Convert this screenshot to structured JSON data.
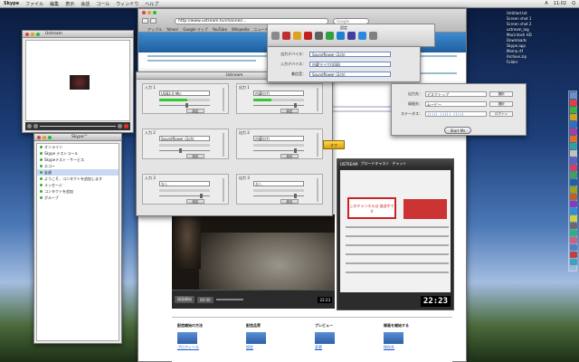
{
  "menubar": {
    "app": "Skype",
    "items": [
      "ファイル",
      "編集",
      "表示",
      "会話",
      "コール",
      "ウィンドウ",
      "ヘルプ"
    ],
    "right_items": [
      "A",
      "11:02",
      "Q"
    ]
  },
  "browser": {
    "url": "http://www.ustream.tv/channel/...",
    "bookmarks": [
      "アップル",
      "Yahoo!",
      "Google マップ",
      "YouTube",
      "Wikipedia",
      "ニュース",
      "人気"
    ],
    "search_placeholder": "Google"
  },
  "skype_window": {
    "title": "Skype",
    "user": "Ustream"
  },
  "contacts_window": {
    "title": "Skype™",
    "status_label": "オンライン",
    "items": [
      "Skype テストコール",
      "Skypeテスト・サービス",
      "エコー",
      "友達",
      "ようこそ、コンタクトを追加します",
      "メッセージ",
      "コンタクトを追加",
      "グループ"
    ]
  },
  "audio_panel": {
    "title": "Ustream",
    "channels": [
      {
        "label": "入力 1",
        "device": "USB2.0 Mic",
        "meter": 0.55,
        "knob": 0.55,
        "button": "設定"
      },
      {
        "label": "出力 1",
        "device": "内蔵出力",
        "meter": 0.35,
        "knob": 0.85,
        "button": "設定"
      },
      {
        "label": "入力 2",
        "device": "Soundflower (2ch)",
        "meter": 0.0,
        "knob": 0.42,
        "button": "設定"
      },
      {
        "label": "出力 2",
        "device": "内蔵出力",
        "meter": 0.0,
        "knob": 0.85,
        "button": "設定"
      },
      {
        "label": "入力 3",
        "device": "なし",
        "meter": 0.0,
        "knob": 0.85,
        "button": "設定"
      },
      {
        "label": "出力 3",
        "device": "なし",
        "meter": 0.0,
        "knob": 0.85,
        "button": "設定"
      }
    ]
  },
  "device_panel": {
    "rows": [
      {
        "label": "出力デバイス：",
        "value": "Soundflower (2ch)"
      },
      {
        "label": "入力デバイス：",
        "value": "内蔵マイク(USB)"
      },
      {
        "label": "着信音：",
        "value": "Soundflower (2ch)"
      }
    ]
  },
  "icon_toolbar": {
    "title": "設定",
    "icons": [
      {
        "name": "general-icon",
        "color": "#8a8a8a"
      },
      {
        "name": "account-icon",
        "color": "#c03030"
      },
      {
        "name": "privacy-icon",
        "color": "#e0a020"
      },
      {
        "name": "notify-icon",
        "color": "#c02020"
      },
      {
        "name": "audio-icon",
        "color": "#606060"
      },
      {
        "name": "call-icon",
        "color": "#30a040"
      },
      {
        "name": "chat-icon",
        "color": "#2080d0"
      },
      {
        "name": "video-icon",
        "color": "#4040a0"
      },
      {
        "name": "update-icon",
        "color": "#2a8adc"
      },
      {
        "name": "advanced-icon",
        "color": "#808080"
      }
    ]
  },
  "right_panel": {
    "rows": [
      {
        "label": "出力先：",
        "value": "デスクトップ",
        "button": "選択"
      },
      {
        "label": "録画先：",
        "value": "ムービー",
        "button": "選択"
      },
      {
        "label": "ステータス：",
        "value": "||||| ||||| |||||",
        "button": "ログイン"
      }
    ],
    "start_label": "Start Ms"
  },
  "video": {
    "buttons": [
      "録画開始",
      "00:00"
    ],
    "time": "22:23"
  },
  "widget": {
    "tabs": [
      "USTREAM",
      "ブロードキャスト",
      "チャット"
    ],
    "banner": "このチャンネルは 放送中です",
    "time": "22:23"
  },
  "badge": "オフ",
  "desktop_files": [
    "Untitled.txt",
    "Screen shot 1",
    "Screen shot 2",
    "ustream_log",
    "Macintosh HD",
    "Downloads",
    "Skype.app",
    "Memo.rtf",
    "Archive.zip",
    "Folder"
  ],
  "dock_colors": [
    "#6a8fd0",
    "#e04040",
    "#40b040",
    "#d0a020",
    "#3070c0",
    "#a040a0",
    "#e07020",
    "#30a0a0",
    "#c0c0c0",
    "#6060c0",
    "#d04060",
    "#40a060",
    "#2060a0",
    "#a0a020",
    "#c06020",
    "#8040c0",
    "#3090d0",
    "#d0d040",
    "#6a6a6a",
    "#30b080",
    "#d06080",
    "#5080c0",
    "#c04040",
    "#40a0c0"
  ],
  "bottom": {
    "columns": [
      {
        "title": "配信開始の方法",
        "link": "プロフィール"
      },
      {
        "title": "配信品質",
        "link": "設定"
      },
      {
        "title": "プレビュー",
        "link": "変更"
      },
      {
        "title": "録画を開始する",
        "link": "保存先"
      }
    ]
  }
}
